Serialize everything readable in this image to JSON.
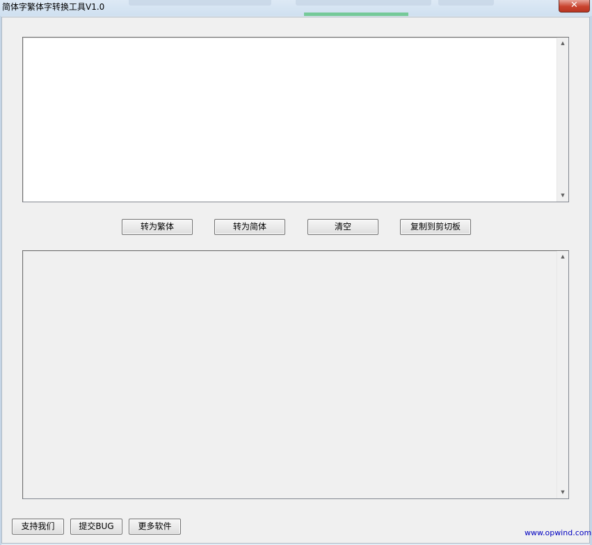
{
  "window": {
    "title": "简体字繁体字转换工具V1.0",
    "close_glyph": "✕"
  },
  "input": {
    "value": ""
  },
  "output": {
    "value": ""
  },
  "actions": {
    "to_traditional": "转为繁体",
    "to_simplified": "转为简体",
    "clear": "清空",
    "copy_clipboard": "复制到剪切板"
  },
  "footer": {
    "support": "支持我们",
    "report_bug": "提交BUG",
    "more_software": "更多软件",
    "site": "www.opwind.com"
  },
  "scroll": {
    "up_glyph": "▲",
    "down_glyph": "▼"
  },
  "colors": {
    "link": "#0000c0",
    "close_button": "#c9442f"
  }
}
